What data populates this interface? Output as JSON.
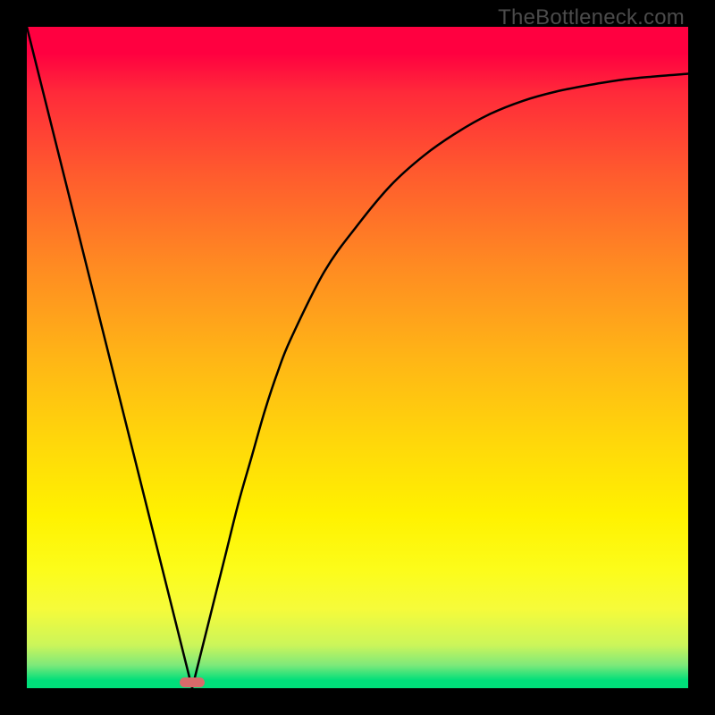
{
  "watermark": {
    "text": "TheBottleneck.com"
  },
  "chart_data": {
    "type": "line",
    "title": "",
    "xlabel": "",
    "ylabel": "",
    "xlim": [
      0,
      100
    ],
    "ylim": [
      0,
      100
    ],
    "series": [
      {
        "name": "curve",
        "x": [
          0,
          2,
          4,
          6,
          8,
          10,
          12,
          14,
          16,
          18,
          20,
          22,
          24,
          25,
          26,
          28,
          30,
          32,
          34,
          36,
          38,
          40,
          45,
          50,
          55,
          60,
          65,
          70,
          75,
          80,
          85,
          90,
          95,
          100
        ],
        "y": [
          100,
          92,
          84,
          76,
          68,
          60,
          52,
          44,
          36,
          28,
          20,
          12,
          4,
          0,
          4,
          12,
          20,
          28,
          35,
          42,
          48,
          53,
          63,
          70,
          76,
          80.5,
          84,
          86.8,
          88.8,
          90.2,
          91.2,
          92,
          92.5,
          92.9
        ]
      }
    ],
    "minimum_marker": {
      "x": 25,
      "y": 0
    },
    "gradient_background": {
      "stops": [
        {
          "pos": 0.0,
          "color": "#ff0040"
        },
        {
          "pos": 0.5,
          "color": "#ffd80a"
        },
        {
          "pos": 0.82,
          "color": "#fcfc1a"
        },
        {
          "pos": 1.0,
          "color": "#00df7a"
        }
      ]
    }
  }
}
